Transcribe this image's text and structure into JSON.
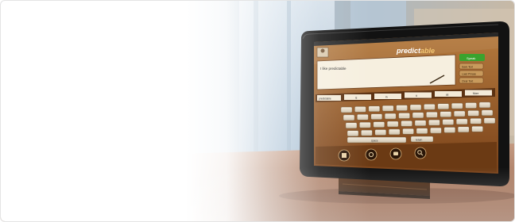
{
  "photo": {
    "subject": "tablet-on-stand",
    "app": {
      "brand_prefix": "predict",
      "brand_suffix": "able",
      "text_entry": "I like predictable",
      "right_buttons": [
        "Speak",
        "Save Text",
        "Load Phrase",
        "Clear Text"
      ],
      "suggestions": [
        "predictable",
        "is",
        "in",
        "it",
        "as"
      ],
      "more_label": "More",
      "space_label": "space",
      "return_label": "return",
      "bottom_icons": [
        "phrase-icon",
        "settings-icon",
        "chat-icon",
        "search-icon"
      ]
    },
    "colors": {
      "wood": "#8a4f22",
      "wood_light": "#b57a3e",
      "speak_green": "#3aa32e",
      "tablet_bezel": "#121212",
      "stand": "#4a2a14",
      "table": "#a9745a"
    }
  }
}
